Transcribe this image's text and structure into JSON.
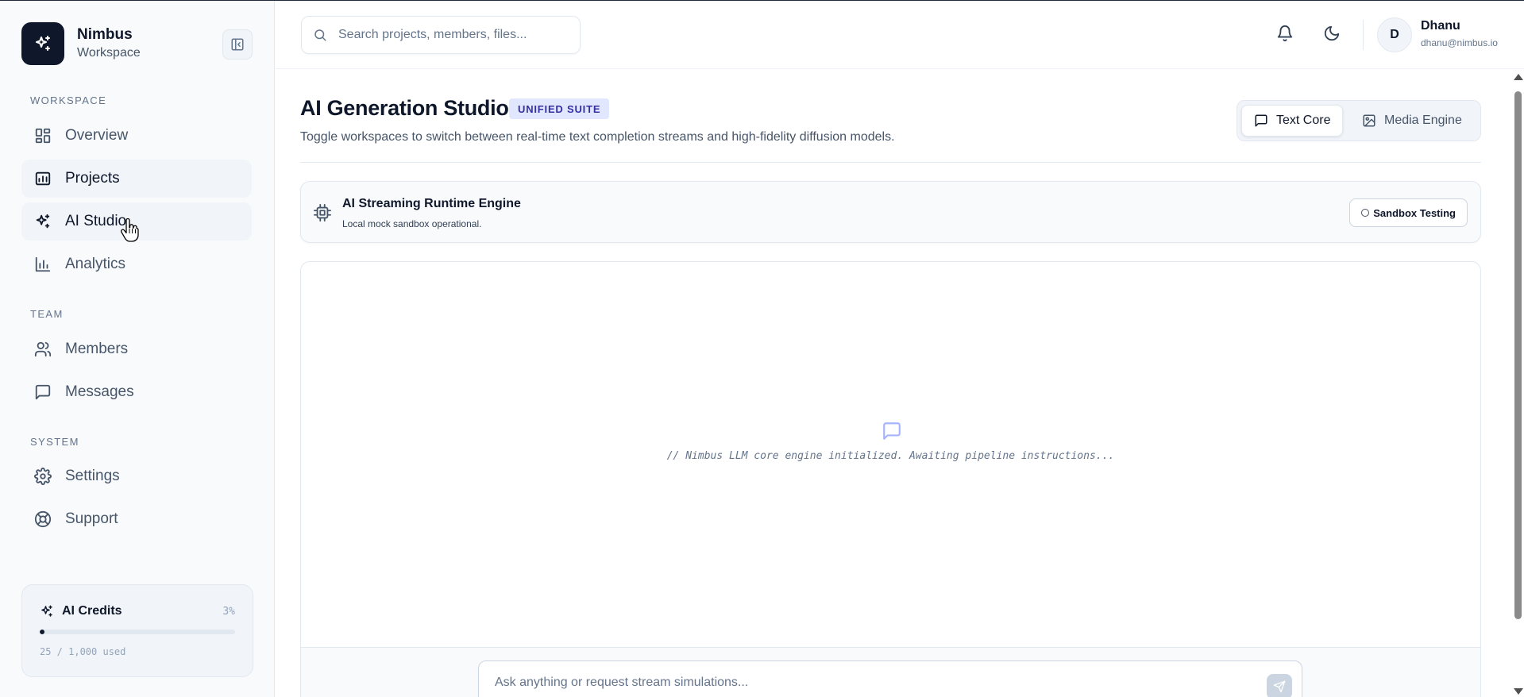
{
  "brand": {
    "name": "Nimbus",
    "subtitle": "Workspace"
  },
  "sidebar": {
    "sections": {
      "workspace": "WORKSPACE",
      "team": "TEAM",
      "system": "SYSTEM"
    },
    "items": [
      {
        "label": "Overview",
        "icon": "layout-grid-icon"
      },
      {
        "label": "Projects",
        "icon": "presentation-chart-icon",
        "active": true
      },
      {
        "label": "AI Studio",
        "icon": "sparkles-icon",
        "hover": true
      },
      {
        "label": "Analytics",
        "icon": "bar-chart-icon"
      },
      {
        "label": "Members",
        "icon": "users-icon"
      },
      {
        "label": "Messages",
        "icon": "message-square-icon"
      },
      {
        "label": "Settings",
        "icon": "gear-icon"
      },
      {
        "label": "Support",
        "icon": "life-buoy-icon"
      }
    ],
    "credits": {
      "title": "AI Credits",
      "percent": "3%",
      "fraction": 0.025,
      "used": "25 / 1,000 used"
    }
  },
  "search": {
    "placeholder": "Search projects, members, files..."
  },
  "user": {
    "initial": "D",
    "name": "Dhanu",
    "email": "dhanu@nimbus.io"
  },
  "page": {
    "title": "AI Generation Studio",
    "badge": "UNIFIED SUITE",
    "subtitle": "Toggle workspaces to switch between real-time text completion streams and high-fidelity diffusion models.",
    "tabs": [
      {
        "label": "Text Core",
        "active": true
      },
      {
        "label": "Media Engine",
        "active": false
      }
    ]
  },
  "engine": {
    "title": "AI Streaming Runtime Engine",
    "subtitle": "Local mock sandbox operational.",
    "status_button": "Sandbox Testing"
  },
  "chat": {
    "empty_message": "// Nimbus LLM core engine initialized. Awaiting pipeline instructions...",
    "input_placeholder": "Ask anything or request stream simulations..."
  },
  "colors": {
    "accent": "#0f172a",
    "badge_bg": "#e0e7ff",
    "badge_text": "#3730a3",
    "chat_icon": "#a5b4fc"
  }
}
